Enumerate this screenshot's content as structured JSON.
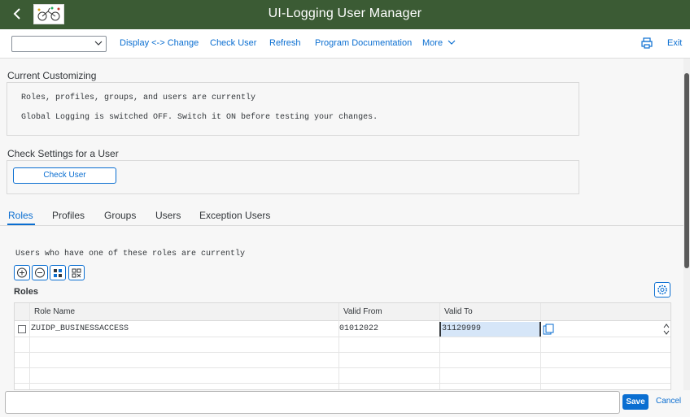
{
  "header": {
    "title": "UI-Logging User Manager",
    "back_icon": "chevron-left-icon",
    "logo_icon": "app-logo-icon"
  },
  "toolbar": {
    "select_value": "",
    "links": [
      "Display <-> Change",
      "Check User",
      "Refresh",
      "Program Documentation",
      "More"
    ],
    "exit_label": "Exit"
  },
  "current_customizing": {
    "title": "Current Customizing",
    "line1": "Roles, profiles, groups, and users are currently",
    "line2": "Global Logging is switched OFF. Switch it ON before testing your changes."
  },
  "check_settings": {
    "title": "Check Settings for a User",
    "button_label": "Check User"
  },
  "tabs": [
    "Roles",
    "Profiles",
    "Groups",
    "Users",
    "Exception Users"
  ],
  "roles_panel": {
    "info": "Users who have one of these roles are currently",
    "title": "Roles",
    "columns": [
      "Role Name",
      "Valid From",
      "Valid To"
    ],
    "rows": [
      {
        "role_name": "ZUIDP_BUSINESSACCESS",
        "valid_from": "01012022",
        "valid_to": "31129999"
      }
    ]
  },
  "footer": {
    "save_label": "Save",
    "cancel_label": "Cancel"
  },
  "colors": {
    "shell": "#3b5b34",
    "accent": "#0a6ed1"
  }
}
